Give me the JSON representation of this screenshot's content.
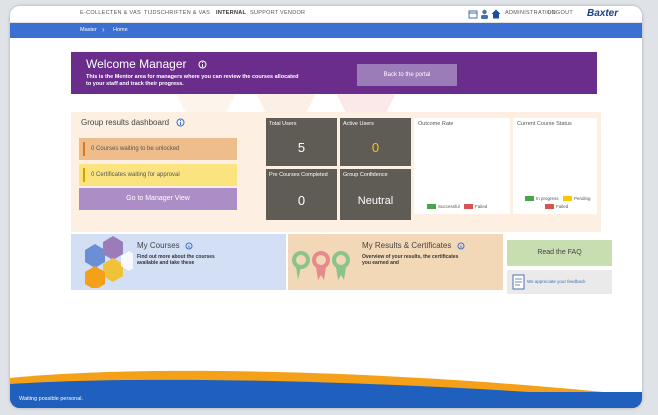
{
  "nav": {
    "links": [
      "E-COLLECTEN & VAS",
      "TIJDSCHRIFTEN & VAS",
      "INTERNAL",
      "SUPPORT",
      "VENDOR"
    ],
    "user_link": "ADMINISTRATION",
    "logout_link": "LOGOUT",
    "brand": "Baxter"
  },
  "breadcrumb": {
    "items": [
      "Master",
      "Home"
    ]
  },
  "welcome": {
    "title": "Welcome Manager",
    "subtitle_line1": "This is the Mentor area for managers where you can review the courses allocated",
    "subtitle_line2": "to your staff and track their progress.",
    "portal_button": "Back to the portal"
  },
  "group_results": {
    "title": "Group results dashboard",
    "banner_unlocked": "0 Courses waiting to be unlocked",
    "banner_approval": "0 Certificates waiting for approval",
    "manager_button": "Go to Manager View",
    "tiles": [
      {
        "label": "Total Users",
        "value": "5"
      },
      {
        "label": "Active Users",
        "value": "0"
      },
      {
        "label": "Pre Courses Completed",
        "value": "0"
      },
      {
        "label": "Group Confidence",
        "value": "Neutral"
      }
    ],
    "colors": {
      "tile": "#5f5c56",
      "accent_yellow": "#f6c900"
    }
  },
  "charts": {
    "outcome": {
      "title": "Outcome Rate",
      "legend": [
        {
          "name": "Successful",
          "color": "#4aa54a"
        },
        {
          "name": "Failed",
          "color": "#d9534f"
        }
      ]
    },
    "course_status": {
      "title": "Current Course Status",
      "legend": [
        {
          "name": "In progress",
          "color": "#4aa54a"
        },
        {
          "name": "Pending",
          "color": "#f6c900"
        },
        {
          "name": "Failed",
          "color": "#d9534f"
        }
      ]
    }
  },
  "cards": {
    "my_courses": {
      "title": "My Courses",
      "desc_line1": "Find out more about the courses",
      "desc_line2": "available and take these"
    },
    "my_results": {
      "title": "My Results & Certificates",
      "desc_line1": "Overview of your results, the certificates",
      "desc_line2": "you earned and"
    },
    "faq_button": "Read the FAQ",
    "feedback_link": "We appreciate your feedback"
  },
  "status_bar": {
    "text": "Waiting possible personal."
  },
  "icons": [
    "info-icon",
    "user-icon",
    "home-icon",
    "calendar-icon",
    "note-icon",
    "hexagon-art",
    "ribbon-art"
  ]
}
